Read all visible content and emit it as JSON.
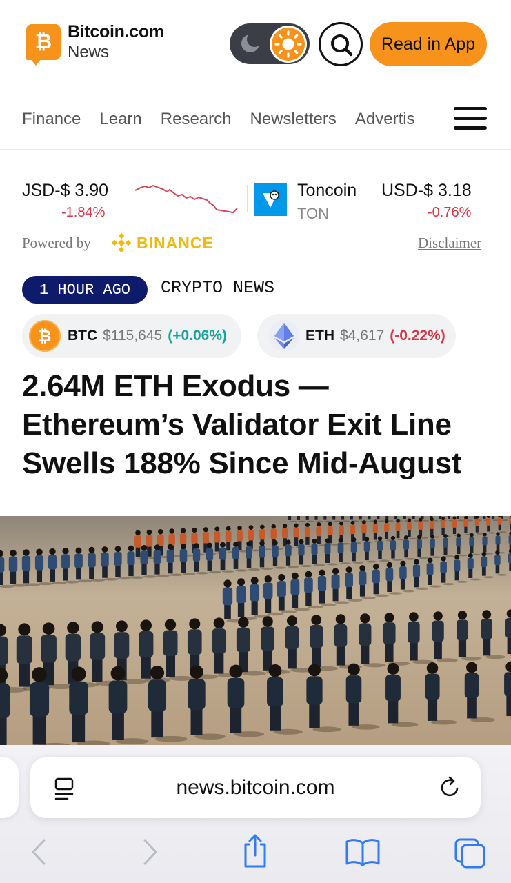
{
  "header": {
    "logo_mark": "₿",
    "logo_name": "Bitcoin.com",
    "logo_sub": "News",
    "read_app_label": "Read in App"
  },
  "nav": {
    "items": [
      "Finance",
      "Learn",
      "Research",
      "Newsletters",
      "Advertis"
    ]
  },
  "ticker": {
    "item1": {
      "price": "JSD-$ 3.90",
      "change": "-1.84%"
    },
    "item2": {
      "name": "Toncoin",
      "symbol": "TON",
      "price": "USD-$ 3.18",
      "change": "-0.76%"
    },
    "powered_by": "Powered by",
    "provider": "BINANCE",
    "disclaimer": "Disclaimer",
    "colors": {
      "negative": "#dc3545",
      "binance": "#f0b90b"
    }
  },
  "article": {
    "time_ago": "1 HOUR AGO",
    "category": "CRYPTO NEWS",
    "coins": [
      {
        "symbol": "BTC",
        "price": "$115,645",
        "change": "(+0.06%)",
        "icon": "bitcoin-icon"
      },
      {
        "symbol": "ETH",
        "price": "$4,617",
        "change": "(-0.22%)",
        "icon": "ethereum-icon"
      }
    ],
    "headline": "2.64M ETH Exodus — Ethereum’s Validator Exit Line Swells 188% Since Mid-August"
  },
  "browser": {
    "url": "news.bitcoin.com"
  },
  "colors": {
    "brand_orange": "#f7931a",
    "badge_navy": "#0e1b6a",
    "positive": "#1aa39a",
    "safari_blue": "#2f7cf6"
  }
}
